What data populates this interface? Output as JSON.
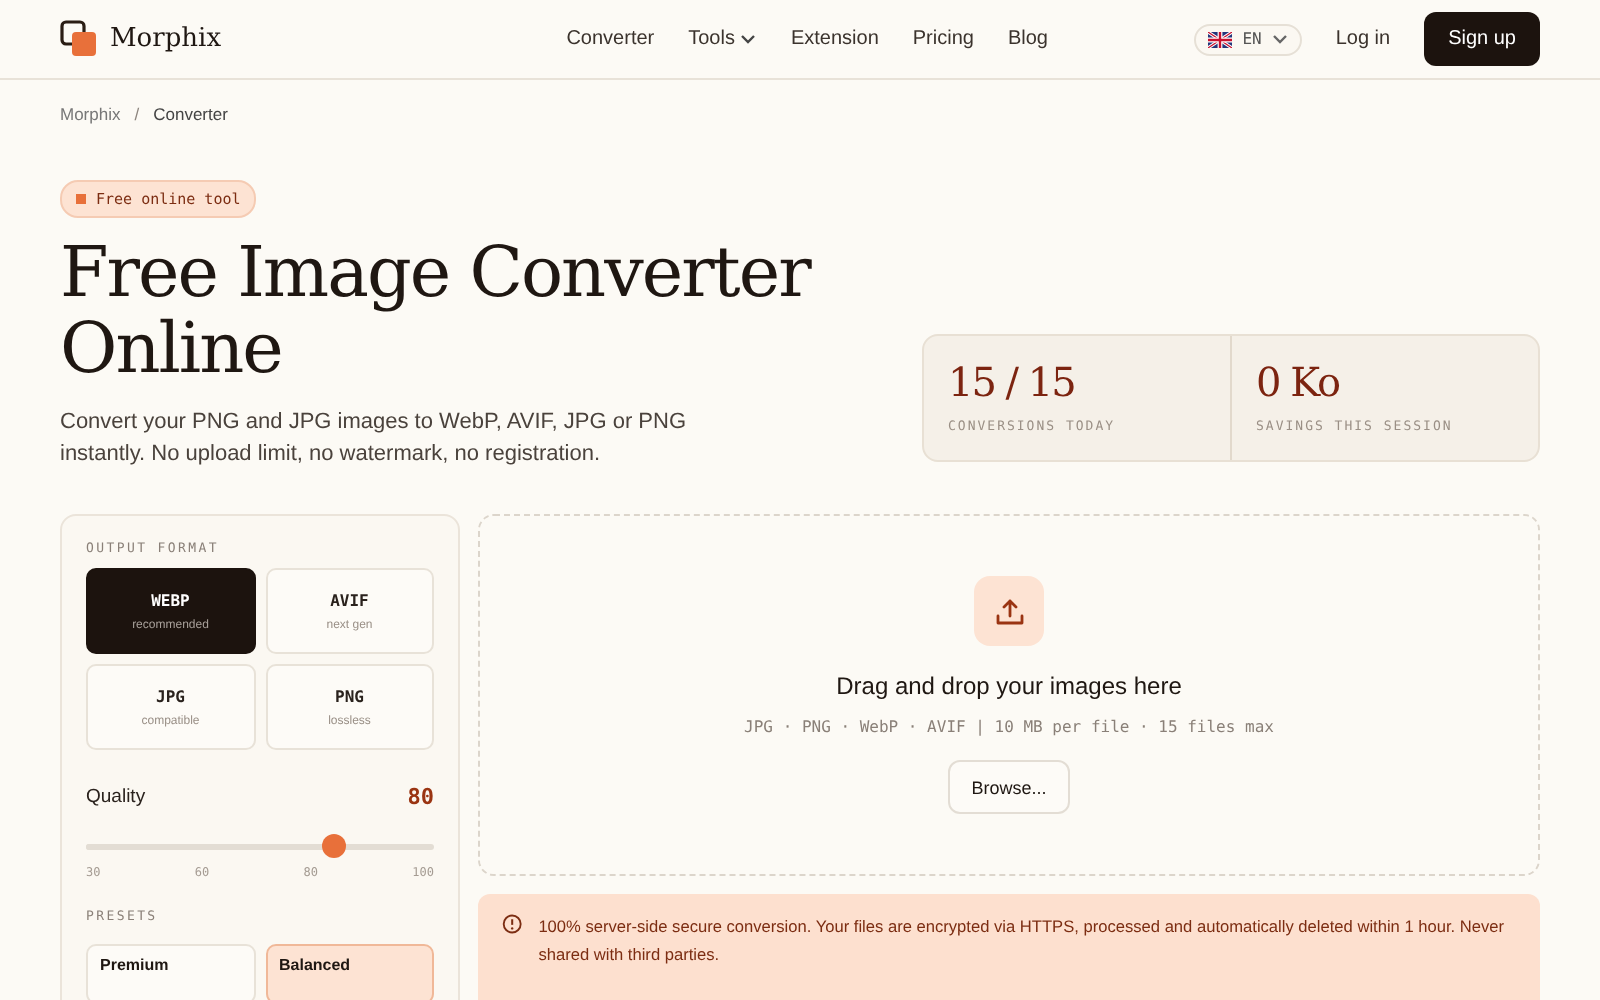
{
  "header": {
    "logo": "Morphix",
    "nav": [
      {
        "label": "Converter",
        "dropdown": false
      },
      {
        "label": "Tools",
        "dropdown": true
      },
      {
        "label": "Extension",
        "dropdown": false
      },
      {
        "label": "Pricing",
        "dropdown": false
      },
      {
        "label": "Blog",
        "dropdown": false
      }
    ],
    "language": "EN",
    "login": "Log in",
    "signup": "Sign up"
  },
  "breadcrumb": {
    "items": [
      "Morphix",
      "Converter"
    ],
    "separator": "/"
  },
  "badge": "Free online tool",
  "title": "Free Image Converter Online",
  "subtitle": "Convert your PNG and JPG images to WebP, AVIF, JPG or PNG instantly. No upload limit, no watermark, no registration.",
  "stats": [
    {
      "value": "15 / 15",
      "label": "CONVERSIONS TODAY"
    },
    {
      "value": "0 Ko",
      "label": "SAVINGS THIS SESSION"
    }
  ],
  "settings": {
    "format_heading": "OUTPUT FORMAT",
    "formats": [
      {
        "name": "WEBP",
        "note": "recommended",
        "selected": true
      },
      {
        "name": "AVIF",
        "note": "next gen",
        "selected": false
      },
      {
        "name": "JPG",
        "note": "compatible",
        "selected": false
      },
      {
        "name": "PNG",
        "note": "lossless",
        "selected": false
      }
    ],
    "quality": {
      "label": "Quality",
      "reading": "80",
      "level": 0.71,
      "ticks": [
        "30",
        "60",
        "80",
        "100"
      ]
    },
    "presets_heading": "PRESETS",
    "presets": [
      {
        "name": "Premium",
        "selected": false
      },
      {
        "name": "Balanced",
        "selected": true
      }
    ]
  },
  "dropzone": {
    "title": "Drag and drop your images here",
    "hint": "JPG · PNG · WebP · AVIF | 10 MB per file · 15 files max",
    "button": "Browse..."
  },
  "notice": "100% server-side secure conversion. Your files are encrypted via HTTPS, processed and automatically deleted within 1 hour. Never shared with third parties."
}
